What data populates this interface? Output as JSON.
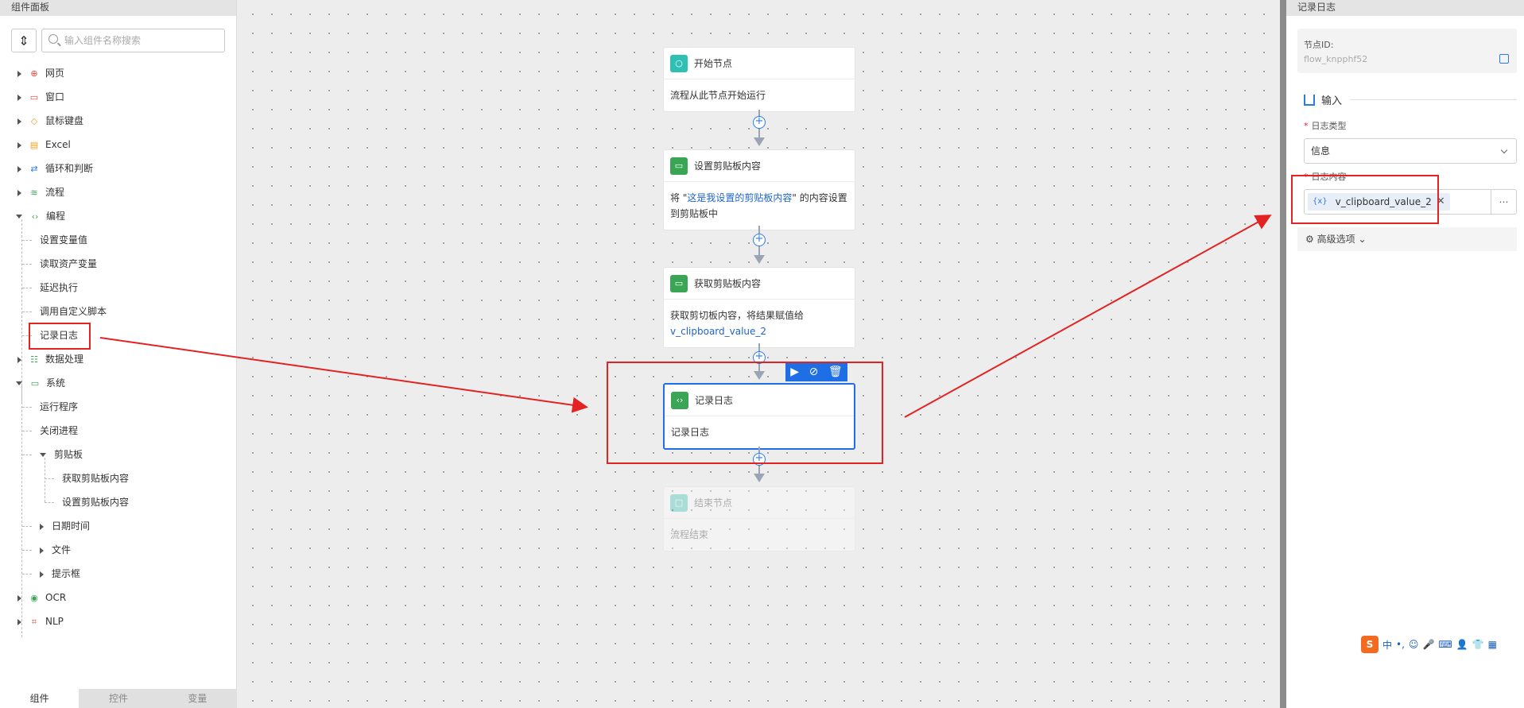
{
  "left_panel": {
    "title": "组件面板",
    "search_placeholder": "输入组件名称搜索",
    "tree": {
      "webpage": "网页",
      "window": "窗口",
      "mouse_keyboard": "鼠标键盘",
      "excel": "Excel",
      "loop": "循环和判断",
      "flow": "流程",
      "programming": "编程",
      "set_var": "设置变量值",
      "read_asset": "读取资产变量",
      "delay": "延迟执行",
      "custom_script": "调用自定义脚本",
      "log": "记录日志",
      "data_proc": "数据处理",
      "system": "系统",
      "run_program": "运行程序",
      "close_process": "关闭进程",
      "clipboard": "剪贴板",
      "get_clip": "获取剪贴板内容",
      "set_clip": "设置剪贴板内容",
      "datetime": "日期时间",
      "file": "文件",
      "prompt": "提示框",
      "ocr": "OCR",
      "nlp": "NLP"
    },
    "tabs": [
      "组件",
      "控件",
      "变量"
    ]
  },
  "canvas": {
    "nodes": [
      {
        "title": "开始节点",
        "body": "流程从此节点开始运行"
      },
      {
        "title": "设置剪贴板内容",
        "body_pre": "将 \"",
        "body_link": "这是我设置的剪贴板内容",
        "body_post": "\" 的内容设置到剪贴板中"
      },
      {
        "title": "获取剪贴板内容",
        "body": "获取剪切板内容，将结果赋值给",
        "body_link": "v_clipboard_value_2"
      },
      {
        "title": "记录日志",
        "body": "记录日志"
      },
      {
        "title": "结束节点",
        "body": "流程结束"
      }
    ]
  },
  "right_panel": {
    "title": "记录日志",
    "node_id_label": "节点ID:",
    "node_id_value": "flow_knpphf52",
    "section_input": "输入",
    "log_type_label": "日志类型",
    "log_type_value": "信息",
    "log_content_label": "日志内容",
    "log_content_var": "v_clipboard_value_2",
    "advanced_label": "高级选项"
  },
  "ime": {
    "zh": "中"
  },
  "colors": {
    "accent": "#1e6ee6",
    "annotation": "#e32222"
  }
}
